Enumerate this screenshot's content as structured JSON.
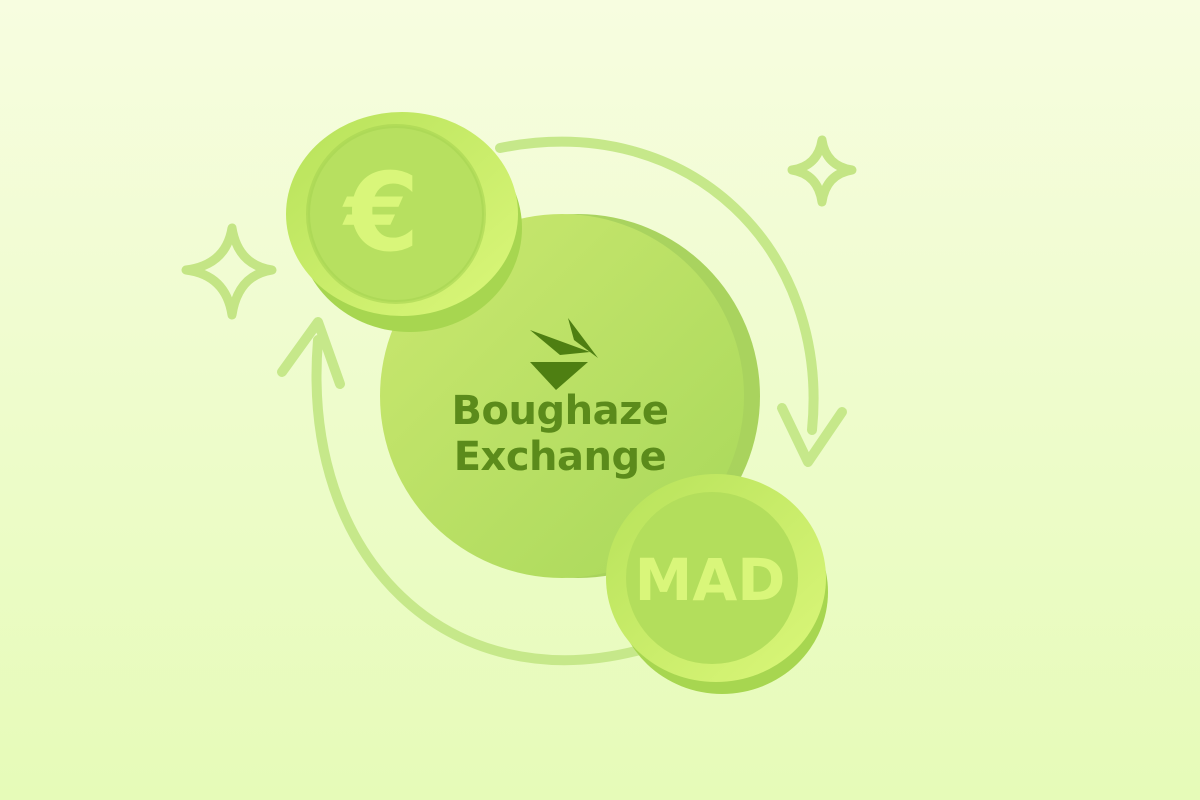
{
  "brand": {
    "line1": "Boughaze",
    "line2": "Exchange"
  },
  "coins": {
    "left_symbol": "€",
    "right_label": "MAD"
  },
  "icons": {
    "logo": "lightning-exchange-icon",
    "sparkle": "sparkle-icon",
    "arrows": "exchange-cycle-arrows"
  },
  "colors": {
    "background_top": "#f7fde0",
    "background_bottom": "#e6fbb8",
    "primary_text": "#5b8b1b",
    "coin_face": "#b6e25d",
    "coin_rim": "#d3f56f",
    "arrow": "#c6e88a"
  }
}
